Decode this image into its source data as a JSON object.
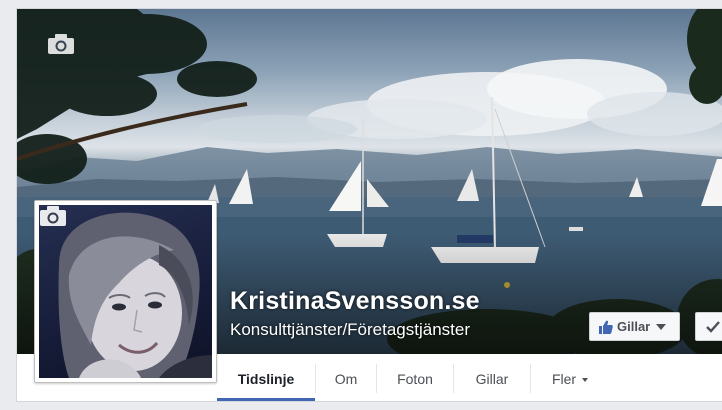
{
  "page": {
    "name": "KristinaSvensson.se",
    "category": "Konsulttjänster/Företagstjänster"
  },
  "actions": {
    "like_label": "Gillar"
  },
  "tabs": [
    {
      "label": "Tidslinje",
      "active": true
    },
    {
      "label": "Om",
      "active": false
    },
    {
      "label": "Foton",
      "active": false
    },
    {
      "label": "Gillar",
      "active": false
    },
    {
      "label": "Fler",
      "active": false,
      "has_dropdown": true
    }
  ],
  "icons": {
    "cover_camera": "camera-icon",
    "profile_camera": "camera-icon",
    "like": "thumbs-up-icon",
    "follow": "checkmark-icon",
    "dropdown": "caret-down-icon"
  },
  "colors": {
    "active_tab_underline": "#4267b2",
    "like_thumb": "#4267b2",
    "page_background": "#e9ebee"
  }
}
